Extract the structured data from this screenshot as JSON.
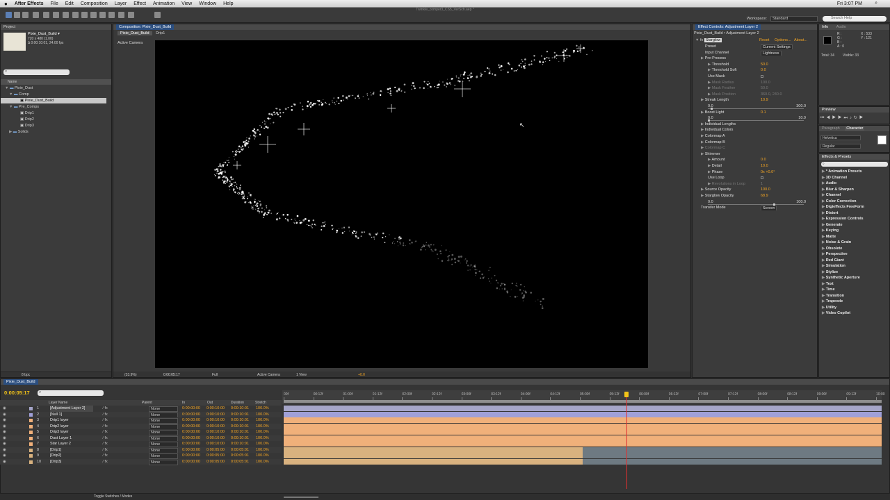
{
  "menubar": {
    "apple": "",
    "app": "After Effects",
    "items": [
      "File",
      "Edit",
      "Composition",
      "Layer",
      "Effect",
      "Animation",
      "View",
      "Window",
      "Help"
    ],
    "doc_title": "Twinkle_comper3_CS5_VerSch.aep *",
    "clock": "Fri 3:07 PM"
  },
  "toolbar": {
    "workspace_label": "Workspace:",
    "workspace_value": "Standard",
    "search_placeholder": "Search Help"
  },
  "project": {
    "tab": "Project",
    "comp_name": "Pixie_Dust_Build ▾",
    "comp_size": "720 x 480 (1.00)",
    "comp_duration": "Δ 0:00:10:01, 24.00 fps",
    "name_col": "Name",
    "tree": [
      "Pixie_Dust",
      "Comp",
      "Pixie_Dust_Build",
      "Pre_Comps",
      "Drip1",
      "Drip2",
      "Drip3",
      "Solids"
    ],
    "bpc": "8 bpc"
  },
  "composition": {
    "tab": "Composition: Pixie_Dust_Build",
    "breadcrumbs": [
      "Pixie_Dust_Build",
      "Drip1"
    ],
    "camera_label": "Active Camera",
    "zoom": "(33.9%)",
    "timecode": "0:00:05:17",
    "resolution": "Full",
    "camera_select": "Active Camera",
    "view_select": "1 View",
    "exposure": "+0.0"
  },
  "effect_controls": {
    "tab": "Effect Controls: Adjustment Layer 2",
    "title": "Pixie_Dust_Build • Adjustment Layer 2",
    "effect": "Starglow",
    "reset": "Reset",
    "options": "Options...",
    "about": "About...",
    "rows": [
      {
        "label": "Preset",
        "value": "Current Settings",
        "indent": 1
      },
      {
        "label": "Input Channel",
        "value": "Lightness",
        "indent": 1
      },
      {
        "label": "Pre-Process",
        "value": "",
        "indent": 0
      },
      {
        "label": "Threshold",
        "value": "50.0",
        "indent": 2
      },
      {
        "label": "Threshold Soft",
        "value": "0.0",
        "indent": 2
      },
      {
        "label": "Use Mask",
        "value": "",
        "indent": 2
      },
      {
        "label": "Mask Radius",
        "value": "100.0",
        "indent": 2,
        "dim": true
      },
      {
        "label": "Mask Feather",
        "value": "50.0",
        "indent": 2,
        "dim": true
      },
      {
        "label": "Mask Position",
        "value": "360.0, 240.0",
        "indent": 2,
        "dim": true
      },
      {
        "label": "Streak Length",
        "value": "10.9",
        "indent": 0
      },
      {
        "label": "",
        "value": "",
        "indent": 0
      },
      {
        "label": "Boost Light",
        "value": "0.1",
        "indent": 0
      },
      {
        "label": "",
        "value": "",
        "indent": 0
      },
      {
        "label": "Individual Lengths",
        "value": "",
        "indent": 0
      },
      {
        "label": "Individual Colors",
        "value": "",
        "indent": 0
      },
      {
        "label": "Colormap A",
        "value": "",
        "indent": 0
      },
      {
        "label": "Colormap B",
        "value": "",
        "indent": 0
      },
      {
        "label": "Colormap C",
        "value": "",
        "indent": 0,
        "dim": true
      },
      {
        "label": "Shimmer",
        "value": "",
        "indent": 0
      },
      {
        "label": "Amount",
        "value": "0.0",
        "indent": 2
      },
      {
        "label": "Detail",
        "value": "10.0",
        "indent": 2
      },
      {
        "label": "Phase",
        "value": "0x +0.0°",
        "indent": 2
      },
      {
        "label": "Use Loop",
        "value": "",
        "indent": 2
      },
      {
        "label": "Revolutions in Loop",
        "value": "1",
        "indent": 2,
        "dim": true
      },
      {
        "label": "Source Opacity",
        "value": "100.0",
        "indent": 0
      },
      {
        "label": "Starglow Opacity",
        "value": "68.9",
        "indent": 0
      },
      {
        "label": "",
        "value": "",
        "indent": 0
      },
      {
        "label": "Transfer Mode",
        "value": "Screen",
        "indent": 0
      }
    ],
    "slider1": {
      "min": "0.0",
      "max": "300.0",
      "pos": 0.036
    },
    "slider2": {
      "min": "0.0",
      "max": "10.0",
      "pos": 0.01
    },
    "slider3": {
      "min": "0.0",
      "max": "100.0",
      "pos": 0.689
    }
  },
  "info": {
    "tabs": [
      "Info",
      "Audio"
    ],
    "x": "X : 533",
    "y": "Y : 121",
    "r": "R :",
    "g": "G :",
    "b": "B :",
    "a": "A : 0",
    "total": "Total: 34",
    "visible": "Visible: 33"
  },
  "preview": {
    "tab": "Preview"
  },
  "character": {
    "tabs": [
      "Paragraph",
      "Character"
    ],
    "font": "Helvetica",
    "style": "Regular"
  },
  "effects_presets": {
    "tab": "Effects & Presets",
    "categories": [
      "* Animation Presets",
      "3D Channel",
      "Audio",
      "Blur & Sharpen",
      "Channel",
      "Color Correction",
      "Digieffects FreeForm",
      "Distort",
      "Expression Controls",
      "Generate",
      "Keying",
      "Matte",
      "Noise & Grain",
      "Obsolete",
      "Perspective",
      "Red Giant",
      "Simulation",
      "Stylize",
      "Synthetic Aperture",
      "Text",
      "Time",
      "Transition",
      "Trapcode",
      "Utility",
      "Video Copilot"
    ]
  },
  "timeline": {
    "tab": "Pixie_Dust_Build",
    "timecode": "0:00:05:17",
    "col_layer": "Layer Name",
    "col_parent": "Parent",
    "col_in": "In",
    "col_out": "Out",
    "col_dur": "Duration",
    "col_stretch": "Stretch",
    "toggle": "Toggle Switches / Modes",
    "ticks": [
      "00f",
      "00:12f",
      "01:00f",
      "01:12f",
      "02:00f",
      "02:12f",
      "03:00f",
      "03:12f",
      "04:00f",
      "04:12f",
      "05:00f",
      "05:12f",
      "06:00f",
      "06:12f",
      "07:00f",
      "07:12f",
      "08:00f",
      "08:12f",
      "09:00f",
      "09:12f",
      "10:00"
    ],
    "layers": [
      {
        "num": "1",
        "name": "[Adjustment Layer 2]",
        "parent": "None",
        "in": "0:00:00:00",
        "out": "0:00:10:00",
        "dur": "0:00:10:01",
        "stretch": "100.0%",
        "color": "#a5a5c8",
        "end": 1.0
      },
      {
        "num": "2",
        "name": "[Null 1]",
        "parent": "None",
        "in": "0:00:00:00",
        "out": "0:00:10:00",
        "dur": "0:00:10:01",
        "stretch": "100.0%",
        "color": "#a0a0d8",
        "end": 1.0
      },
      {
        "num": "3",
        "name": "Drip1 layer",
        "parent": "None",
        "in": "0:00:00:00",
        "out": "0:00:10:00",
        "dur": "0:00:10:01",
        "stretch": "100.0%",
        "color": "#f0b07a",
        "end": 1.0
      },
      {
        "num": "4",
        "name": "Drip2 layer",
        "parent": "None",
        "in": "0:00:00:00",
        "out": "0:00:10:00",
        "dur": "0:00:10:01",
        "stretch": "100.0%",
        "color": "#f0b07a",
        "end": 1.0
      },
      {
        "num": "5",
        "name": "Drip3 layer",
        "parent": "None",
        "in": "0:00:00:00",
        "out": "0:00:10:00",
        "dur": "0:00:10:01",
        "stretch": "100.0%",
        "color": "#f0b07a",
        "end": 1.0
      },
      {
        "num": "6",
        "name": "Dust Layer 1",
        "parent": "None",
        "in": "0:00:00:00",
        "out": "0:00:10:00",
        "dur": "0:00:10:01",
        "stretch": "100.0%",
        "color": "#f0b07a",
        "end": 1.0
      },
      {
        "num": "7",
        "name": "Star Layer 2",
        "parent": "None",
        "in": "0:00:00:00",
        "out": "0:00:10:00",
        "dur": "0:00:10:01",
        "stretch": "100.0%",
        "color": "#f0b07a",
        "end": 1.0
      },
      {
        "num": "8",
        "name": "[Drip1]",
        "parent": "None",
        "in": "0:00:00:00",
        "out": "0:00:05:00",
        "dur": "0:00:05:01",
        "stretch": "100.0%",
        "color": "#d9b27f",
        "end": 0.5
      },
      {
        "num": "9",
        "name": "[Drip2]",
        "parent": "None",
        "in": "0:00:00:00",
        "out": "0:00:05:00",
        "dur": "0:00:05:01",
        "stretch": "100.0%",
        "color": "#d9b27f",
        "end": 0.5
      },
      {
        "num": "10",
        "name": "[Drip3]",
        "parent": "None",
        "in": "0:00:00:00",
        "out": "0:00:05:00",
        "dur": "0:00:05:01",
        "stretch": "100.0%",
        "color": "#d9b27f",
        "end": 0.5
      }
    ],
    "playhead_fraction": 0.573
  },
  "colors": {
    "accent": "#2c4f80",
    "timecode": "#f5c518",
    "value": "#f5a623",
    "playhead": "#e03030"
  }
}
